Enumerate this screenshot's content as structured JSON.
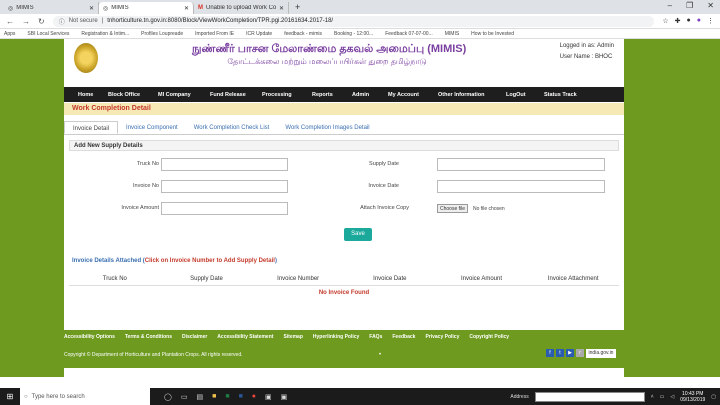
{
  "browser": {
    "tabs": [
      {
        "label": "MIMIS",
        "icon": "globe-icon"
      },
      {
        "label": "MIMIS",
        "icon": "globe-icon"
      },
      {
        "label": "Unable to upload Work Compl",
        "icon": "gmail-icon"
      }
    ],
    "url_prefix": "Not secure",
    "url": "tnhorticulture.tn.gov.in:8080/Block/ViewWorkCompletion/TPR.pgi.20161634.2017-18/",
    "bookmarks": [
      "Apps",
      "SBI Local Services",
      "Registration & Intim...",
      "Profiles Loupreade",
      "Imported From IE",
      "ICR Update",
      "feedback - mimis",
      "Booking - 12:00...",
      "Feedback 07-07-00...",
      "MIMIS",
      "How to be Invested"
    ]
  },
  "header": {
    "title_tamil": "நுண்ணீர் பாசன மேலாண்மை தகவல் அமைப்பு (MIMIS)",
    "subtitle_tamil": "தோட்டக்கலை மற்றும் மலைப்பயிர்கள் துறை தமிழ்நாடு",
    "user_line1": "Logged in as: Admin",
    "user_line2": "User Name : BHOC"
  },
  "menu": [
    "Home",
    "Block Office",
    "MI Company",
    "Fund Release",
    "Processing",
    "Reports",
    "Admin",
    "My Account",
    "Other Information",
    "LogOut",
    "Status Track"
  ],
  "section_title": "Work Completion Detail",
  "subtabs": [
    "Invoice Detail",
    "Invoice Component",
    "Work Completion Check List",
    "Work Completion Images Detail"
  ],
  "form": {
    "heading": "Add New Supply Details",
    "truck_no": "Truck No",
    "supply_date": "Supply Date",
    "invoice_no": "Invoice No",
    "invoice_date": "Invoice Date",
    "invoice_amount": "Invoice Amount",
    "attach_copy": "Attach Invoice Copy",
    "choose_file": "Choose file",
    "no_file": "No file chosen",
    "save": "Save"
  },
  "attached": {
    "prefix": "Invoice Details Attached (",
    "link": "Click on Invoice Number to Add Supply Detail",
    "suffix": ")"
  },
  "table_headers": [
    "Truck No",
    "Supply Date",
    "Invoice Number",
    "Invoice Date",
    "Invoice Amount",
    "Invoice Attachment"
  ],
  "no_invoice": "No Invoice Found",
  "footer": {
    "links": [
      "Accessibility Options",
      "Terms & Conditions",
      "Disclaimer",
      "Accessibility Statement",
      "Sitemap",
      "Hyperlinking Policy",
      "FAQs",
      "Feedback",
      "Privacy Policy",
      "Copyright Policy"
    ],
    "copyright": "Copyright © Department of Horticulture and Plantation Crops. All rights reserved.",
    "india_gov": "india.gov.in"
  },
  "taskbar": {
    "search_placeholder": "Type here to search",
    "address_label": "Address",
    "time": "10:43 PM",
    "date": "09/13/2019"
  }
}
